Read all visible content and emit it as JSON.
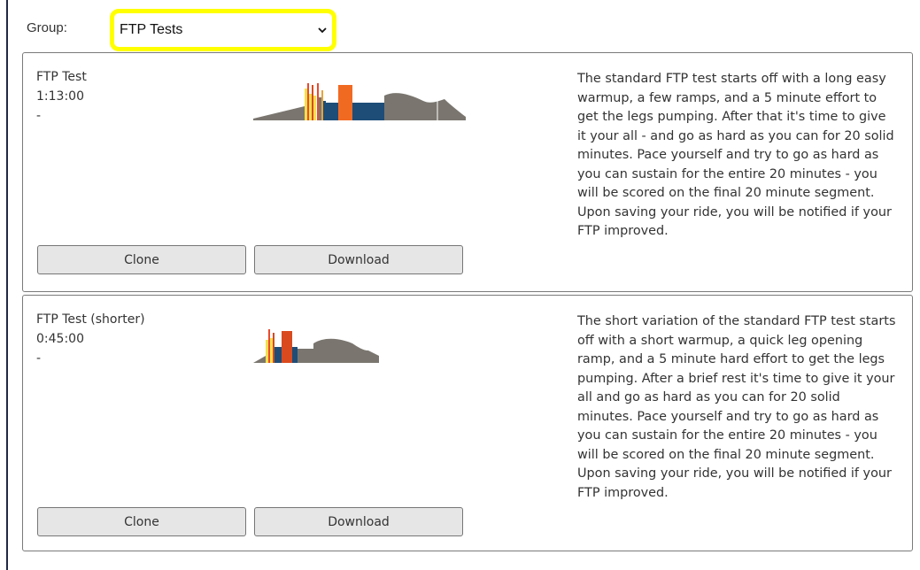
{
  "filter": {
    "label": "Group:",
    "selected": "FTP Tests"
  },
  "colors": {
    "highlight": "#ffff00",
    "terrain": "#7a766f",
    "z1": "#f4e04d",
    "z2": "#e8a33a",
    "z3": "#d94a1e",
    "z4": "#e84a2f",
    "navy": "#1e4d78",
    "orange": "#f16a22"
  },
  "workouts": [
    {
      "name": "FTP Test",
      "duration": "1:13:00",
      "extra": "-",
      "description": "The standard FTP test starts off with a long easy warmup, a few ramps, and a 5 minute effort to get the legs pumping. After that it's time to give it your all - and go as hard as you can for 20 solid minutes. Pace yourself and try to go as hard as you can sustain for the entire 20 minutes - you will be scored on the final 20 minute segment. Upon saving your ride, you will be notified if your FTP improved.",
      "clone_label": "Clone",
      "download_label": "Download"
    },
    {
      "name": "FTP Test (shorter)",
      "duration": "0:45:00",
      "extra": "-",
      "description": "The short variation of the standard FTP test starts off with a short warmup, a quick leg opening ramp, and a 5 minute hard effort to get the legs pumping. After a brief rest it's time to give it your all and go as hard as you can for 20 solid minutes. Pace yourself and try to go as hard as you can sustain for the entire 20 minutes - you will be scored on the final 20 minute segment. Upon saving your ride, you will be notified if your FTP improved.",
      "clone_label": "Clone",
      "download_label": "Download"
    }
  ]
}
